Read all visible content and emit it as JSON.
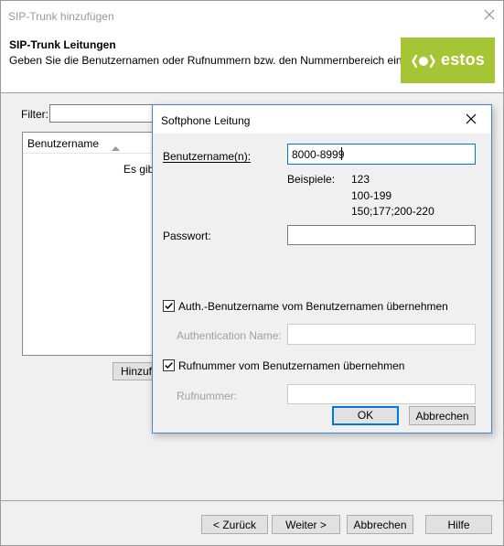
{
  "wizard": {
    "title": "SIP-Trunk hinzufügen",
    "heading": "SIP-Trunk Leitungen",
    "description": "Geben Sie die Benutzernamen oder Rufnummern bzw. den Nummernbereich ein.",
    "logo_text": "estos",
    "filter_label": "Filter:",
    "filter_value": "",
    "list": {
      "column_username": "Benutzername",
      "empty_text": "Es gibt"
    },
    "add_button": "Hinzufügen...",
    "buttons": {
      "back": "< Zurück",
      "next": "Weiter >",
      "cancel": "Abbrechen",
      "help": "Hilfe"
    }
  },
  "dialog": {
    "title": "Softphone Leitung",
    "username_label": "Benutzername(n):",
    "username_value": "8000-8999",
    "examples_label": "Beispiele:",
    "examples": [
      "123",
      "100-199",
      "150;177;200-220"
    ],
    "password_label": "Passwort:",
    "password_value": "",
    "auth_checkbox_label": "Auth.-Benutzername vom Benutzernamen übernehmen",
    "auth_checked": true,
    "auth_name_label": "Authentication Name:",
    "auth_name_value": "",
    "phone_checkbox_label": "Rufnummer vom Benutzernamen übernehmen",
    "phone_checked": true,
    "phone_label": "Rufnummer:",
    "phone_value": "",
    "ok_label": "OK",
    "cancel_label": "Abbrechen"
  },
  "colors": {
    "accent": "#0078d7",
    "logo_green": "#a6c534"
  }
}
